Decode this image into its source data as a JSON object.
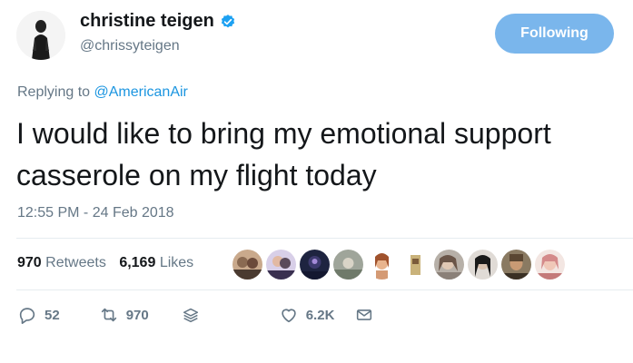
{
  "user": {
    "display_name": "christine teigen",
    "handle": "@chrissyteigen",
    "verified": true
  },
  "follow_button": {
    "label": "Following",
    "color": "#7ab6ec"
  },
  "reply": {
    "prefix": "Replying to ",
    "mention": "@AmericanAir"
  },
  "tweet": {
    "text": "I would like to bring my emotional support casserole on my flight today",
    "timestamp": "12:55 PM - 24 Feb 2018"
  },
  "stats": {
    "retweets_count": "970",
    "retweets_label": "Retweets",
    "likes_count": "6,169",
    "likes_label": "Likes"
  },
  "liker_avatars": [
    "avatar-1",
    "avatar-2",
    "avatar-3",
    "avatar-4",
    "avatar-5",
    "avatar-6",
    "avatar-7",
    "avatar-8",
    "avatar-9"
  ],
  "actions": {
    "reply_count": "52",
    "retweet_count": "970",
    "like_count": "6.2K"
  },
  "icons": {
    "verified": "verified-badge-icon",
    "reply": "reply-icon",
    "retweet": "retweet-icon",
    "stack": "layers-icon",
    "like": "heart-icon",
    "message": "envelope-icon"
  },
  "colors": {
    "link": "#1b95e0",
    "muted": "#657786",
    "text": "#14171a",
    "verified": "#1da1f2"
  }
}
